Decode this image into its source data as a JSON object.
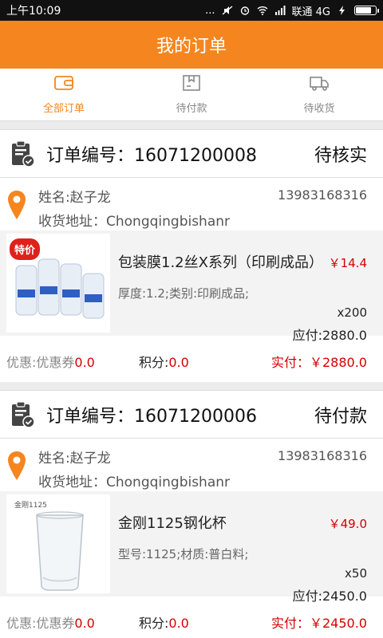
{
  "status_bar": {
    "time": "上午10:09",
    "dots": "...",
    "carrier": "联通 4G",
    "battery_level": 0.85
  },
  "header": {
    "title": "我的订单"
  },
  "tabs": [
    {
      "label": "全部订单",
      "active": true,
      "icon": "wallet-icon"
    },
    {
      "label": "待付款",
      "active": false,
      "icon": "package-icon"
    },
    {
      "label": "待收货",
      "active": false,
      "icon": "truck-icon"
    }
  ],
  "orders": [
    {
      "order_no": "订单编号：16071200008",
      "state": "待核实",
      "name": "姓名:赵子龙",
      "phone": "13983168316",
      "address": "收货地址：Chongqingbishanr",
      "product": {
        "title": "包装膜1.2丝X系列（印刷成品）",
        "price": "￥14.4",
        "spec": "厚度:1.2;类别:印刷成品;",
        "qty": "x200",
        "due": "应付:2880.0",
        "badge": "特价"
      },
      "coupon_label": "优惠:优惠券",
      "coupon_value": "0.0",
      "points_label": "积分:",
      "points_value": "0.0",
      "paid": "实付：￥2880.0"
    },
    {
      "order_no": "订单编号：16071200006",
      "state": "待付款",
      "name": "姓名:赵子龙",
      "phone": "13983168316",
      "address": "收货地址：Chongqingbishanr",
      "product": {
        "title": "金刚1125钢化杯",
        "price": "￥49.0",
        "spec": "型号:1125;材质:普白料;",
        "qty": "x50",
        "due": "应付:2450.0",
        "image_caption": "金刚1125"
      },
      "coupon_label": "优惠:优惠券",
      "coupon_value": "0.0",
      "points_label": "积分:",
      "points_value": "0.0",
      "paid": "实付：￥2450.0"
    }
  ]
}
